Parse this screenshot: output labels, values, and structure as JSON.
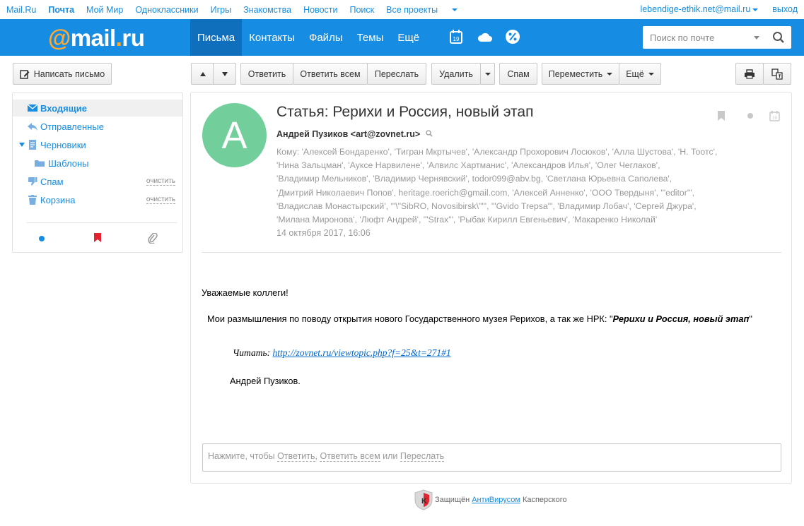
{
  "portal": {
    "links": [
      "Mail.Ru",
      "Почта",
      "Мой Мир",
      "Одноклассники",
      "Игры",
      "Знакомства",
      "Новости",
      "Поиск",
      "Все проекты"
    ],
    "account": "lebendige-ethik.net@mail.ru",
    "logout": "выход"
  },
  "header": {
    "logo_at": "@",
    "logo_main": "mail",
    "logo_dot": ".",
    "logo_tld": "ru",
    "nav": [
      "Письма",
      "Контакты",
      "Файлы",
      "Темы",
      "Ещё"
    ],
    "calendar_day": "19",
    "search_placeholder": "Поиск по почте"
  },
  "toolbar": {
    "compose": "Написать письмо",
    "reply": "Ответить",
    "reply_all": "Ответить всем",
    "forward": "Переслать",
    "delete": "Удалить",
    "spam": "Спам",
    "move": "Переместить",
    "more": "Ещё"
  },
  "sidebar": {
    "folders": [
      {
        "label": "Входящие",
        "icon": "envelope-icon"
      },
      {
        "label": "Отправленные",
        "icon": "reply-arrow-icon"
      },
      {
        "label": "Черновики",
        "icon": "draft-page-icon"
      },
      {
        "label": "Шаблоны",
        "icon": "folder-icon"
      },
      {
        "label": "Спам",
        "icon": "thumbs-down-icon",
        "action": "очистить"
      },
      {
        "label": "Корзина",
        "icon": "trash-icon",
        "action": "очистить"
      }
    ],
    "filters": [
      "unread-dot-icon",
      "flag-icon",
      "paperclip-icon"
    ]
  },
  "message": {
    "avatar_letter": "А",
    "subject": "Статья: Рерихи и Россия, новый этап",
    "sender": "Андрей Пузиков <art@zovnet.ru>",
    "to_lines": [
      "Кому: 'Алексей Бондаренко', 'Тигран Мкртычев', 'Александр Прохорович Лосюков', 'Алла Шустова', 'Н. Тоотс',",
      "'Нина Зальцман', 'Ауксе Нарвилене', 'Алвилс Хартманис', 'Александров Илья', 'Олег Чеглаков',",
      "'Владимир Мельников', 'Владимир Чернявский', todor099@abv.bg, 'Светлана Юрьевна Саполева',",
      "'Дмитрий Николаевич Попов', heritage.roerich@gmail.com, 'Алексей Анненко', 'ООО Твердыня', '\"editor\"',",
      "'Владислав Монастырский', '\"\\\"SibRO, Novosibirsk\\\"\"', '\"Gvido Trepsa\"', 'Владимир Лобач', 'Сергей Джура',",
      "'Милана Миронова', 'Люфт Андрей', '\"Strax\"', 'Рыбак Кирилл Евгеньевич', 'Макаренко Николай'"
    ],
    "date": "14 октября 2017, 16:06",
    "greeting": "Уважаемые коллеги!",
    "intro": "Мои размышления по поводу открытия нового Государственного музея Рерихов, а так же НРК: \"",
    "intro_title": "Рерихи и Россия, новый этап",
    "intro_end": "\"",
    "read_label": "Читать: ",
    "read_link": "http://zovnet.ru/viewtopic.php?f=25&t=271#1",
    "signature": "Андрей Пузиков."
  },
  "reply_box": {
    "prefix": "Нажмите, чтобы ",
    "reply": "Ответить",
    "sep": ", ",
    "reply_all": "Ответить всем",
    "or": " или ",
    "forward": "Переслать"
  },
  "footer": {
    "protected": "Защищён",
    "antivirus": "АнтиВирусом",
    "vendor": "Касперского"
  },
  "colors": {
    "brand_blue": "#168de2",
    "nav_active": "#0f6fbd",
    "logo_orange": "#ffa930",
    "avatar_green": "#72ce9b",
    "flag_red": "#e3232f"
  }
}
